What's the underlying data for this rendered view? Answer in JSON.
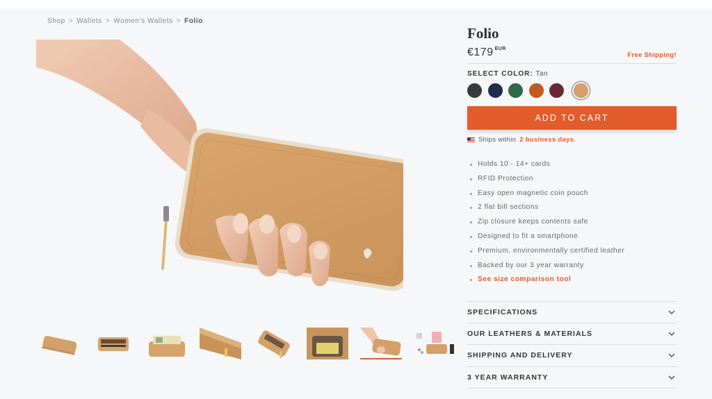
{
  "breadcrumb": {
    "items": [
      "Shop",
      "Wallets",
      "Women's Wallets"
    ],
    "current": "Folio",
    "separator": ">"
  },
  "product": {
    "title": "Folio",
    "price": "€179",
    "currency": "EUR",
    "free_shipping": "Free Shipping!",
    "select_color_label": "SELECT COLOR:",
    "selected_color": "Tan",
    "colors": [
      {
        "name": "charcoal",
        "hex": "#3a3a3a"
      },
      {
        "name": "navy",
        "hex": "#1f2d4d"
      },
      {
        "name": "forest green",
        "hex": "#2e6b4a"
      },
      {
        "name": "orange",
        "hex": "#c55a1f"
      },
      {
        "name": "burgundy",
        "hex": "#6b2a33"
      },
      {
        "name": "tan",
        "hex": "#d6a067"
      }
    ],
    "add_to_cart": "ADD TO CART",
    "ships_prefix": "Ships within",
    "ships_days": "2 business days",
    "ships_suffix": ".",
    "features": [
      "Holds 10 - 14+ cards",
      "RFID Protection",
      "Easy open magnetic coin pouch",
      "2 flat bill sections",
      "Zip closure keeps contents safe",
      "Designed to fit a smartphone",
      "Premium, environmentally certified leather",
      "Backed by our 3 year warranty"
    ],
    "comparison_link": "See size comparison tool"
  },
  "accordion": [
    {
      "label": "SPECIFICATIONS"
    },
    {
      "label": "OUR LEATHERS & MATERIALS"
    },
    {
      "label": "SHIPPING AND DELIVERY"
    },
    {
      "label": "3 YEAR WARRANTY"
    }
  ],
  "gallery": {
    "active_thumb_index": 6,
    "thumb_count": 8,
    "accent": "#e25c2c"
  }
}
